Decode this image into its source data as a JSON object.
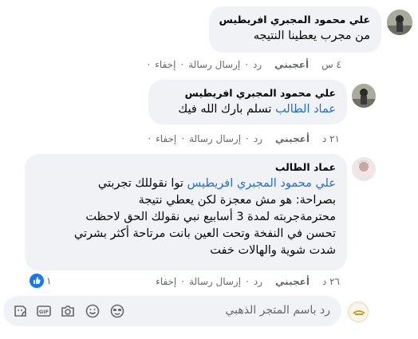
{
  "comments": [
    {
      "author": "علي محمود المجبري افريطيس",
      "text_lines": [
        "من مجرب يعطينا النتيجه"
      ],
      "time": "٤ س",
      "like_label": "أعجبني",
      "reply_label": "رد",
      "send_message_label": "إرسال رسالة",
      "hide_label": "إخفاء"
    },
    {
      "author": "علي محمود المجبري افريطيس",
      "mention": "عماد الطالب",
      "text_after_mention": "تسلم بارك الله فيك",
      "time": "٢١ د",
      "like_label": "أعجبني",
      "reply_label": "رد",
      "send_message_label": "إرسال رسالة",
      "hide_label": "إخفاء"
    },
    {
      "author": "عماد الطالب",
      "mention": "علي محمود المجبري افريطيس",
      "text_after_mention": "توا نقوللك تجربتي",
      "text_lines": [
        "بصراحة: هو مش معجزة لكن يعطي نتيجة",
        "محترمةجربته لمدة 3 أسابيع نبي نقولك الحق لاحظت",
        "تحسن في النفخة وتحت العين بانت مرتاحة أكثر بشرتي",
        "شدت شوية والهالات خفت"
      ],
      "time": "٢٦ د",
      "like_label": "أعجبني",
      "reply_label": "رد",
      "send_message_label": "إرسال رسالة",
      "hide_label": "إخفاء",
      "reaction_count": "١",
      "reaction_icon": "like-icon"
    }
  ],
  "reply_box": {
    "placeholder": "رد باسم المتجر الذهبي",
    "tools": [
      "sticker-icon",
      "gif-icon",
      "camera-icon",
      "emoji-icon",
      "avatar-sticker-icon"
    ]
  },
  "colors": {
    "bubble": "#f0f2f5",
    "mention": "#216fdb",
    "muted": "#65676b",
    "like_blue": "#1877f2"
  }
}
